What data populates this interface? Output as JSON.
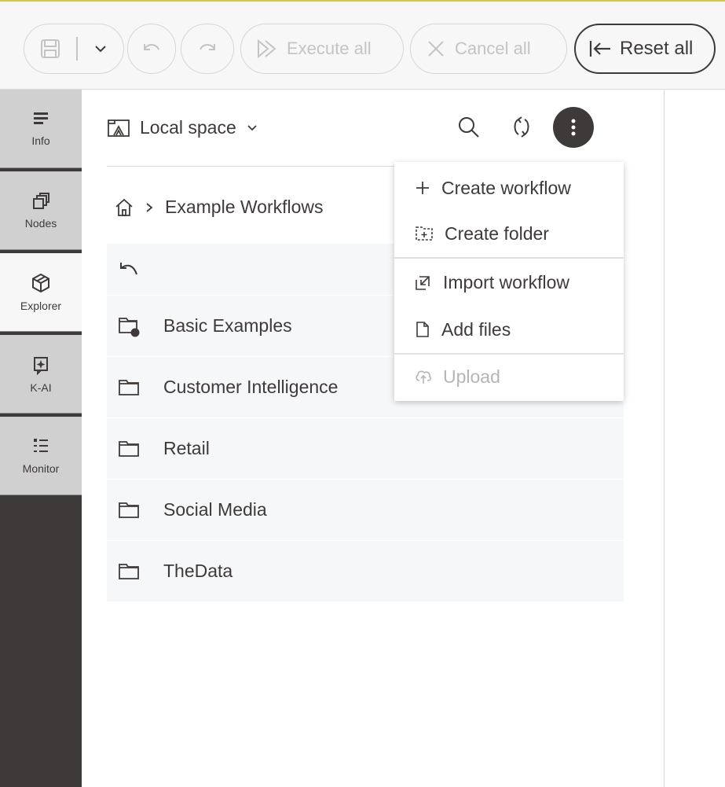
{
  "toolbar": {
    "execute_all": "Execute all",
    "cancel_all": "Cancel all",
    "reset_all": "Reset all"
  },
  "rail": {
    "tabs": [
      {
        "label": "Info",
        "icon": "info-lines-icon",
        "active": false
      },
      {
        "label": "Nodes",
        "icon": "nodes-icon",
        "active": false
      },
      {
        "label": "Explorer",
        "icon": "explorer-cube-icon",
        "active": true
      },
      {
        "label": "K-AI",
        "icon": "k-ai-icon",
        "active": false
      },
      {
        "label": "Monitor",
        "icon": "monitor-list-icon",
        "active": false
      }
    ]
  },
  "explorer": {
    "space": "Local space",
    "breadcrumb": {
      "current": "Example Workflows"
    },
    "items": [
      {
        "name": "Basic Examples",
        "icon": "folder-with-dot-icon"
      },
      {
        "name": "Customer Intelligence",
        "icon": "folder-icon"
      },
      {
        "name": "Retail",
        "icon": "folder-icon"
      },
      {
        "name": "Social Media",
        "icon": "folder-icon"
      },
      {
        "name": "TheData",
        "icon": "folder-icon"
      }
    ]
  },
  "menu": {
    "items": [
      {
        "label": "Create workflow",
        "icon": "plus-icon",
        "enabled": true
      },
      {
        "label": "Create folder",
        "icon": "folder-plus-icon",
        "enabled": true
      },
      {
        "label": "Import workflow",
        "icon": "import-icon",
        "enabled": true
      },
      {
        "label": "Add files",
        "icon": "file-icon",
        "enabled": true
      },
      {
        "label": "Upload",
        "icon": "cloud-upload-icon",
        "enabled": false
      }
    ]
  },
  "colors": {
    "dark": "#3e3a39",
    "rail_tab": "#d0d0d0",
    "row_bg": "#f6f7f8",
    "accent": "#d9c15a"
  }
}
